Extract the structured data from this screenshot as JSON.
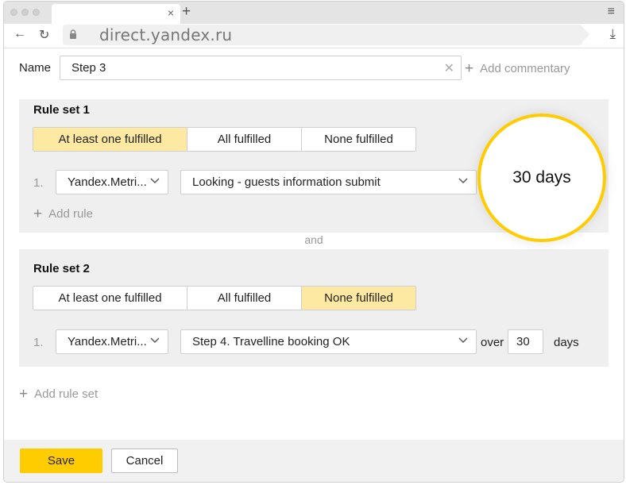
{
  "browser": {
    "url": "direct.yandex.ru",
    "tab_close": "×",
    "new_tab": "+",
    "menu": "≡"
  },
  "form": {
    "name_label": "Name",
    "name_value": "Step 3",
    "clear": "✕",
    "add_commentary": "Add commentary"
  },
  "rule_sets": [
    {
      "title": "Rule set 1",
      "options": [
        "At least one fulfilled",
        "All fulfilled",
        "None fulfilled"
      ],
      "selected": "At least one fulfilled",
      "rules": [
        {
          "number": "1.",
          "source": "Yandex.Metri...",
          "goal": "Looking - guests information submit"
        }
      ],
      "add_rule": "Add rule"
    },
    {
      "title": "Rule set 2",
      "options": [
        "At least one fulfilled",
        "All fulfilled",
        "None fulfilled"
      ],
      "selected": "None fulfilled",
      "rules": [
        {
          "number": "1.",
          "source": "Yandex.Metri...",
          "goal": "Step 4. Travelline booking OK",
          "over_label": "over",
          "days_value": "30",
          "days_label": "days"
        }
      ]
    }
  ],
  "and_label": "and",
  "add_rule_set": "Add rule set",
  "footer": {
    "save": "Save",
    "cancel": "Cancel"
  },
  "callout": {
    "text": "30 days"
  },
  "colors": {
    "accent": "#ffcc00",
    "selected_segment": "#fde9a1",
    "panel_bg": "#efefef"
  }
}
